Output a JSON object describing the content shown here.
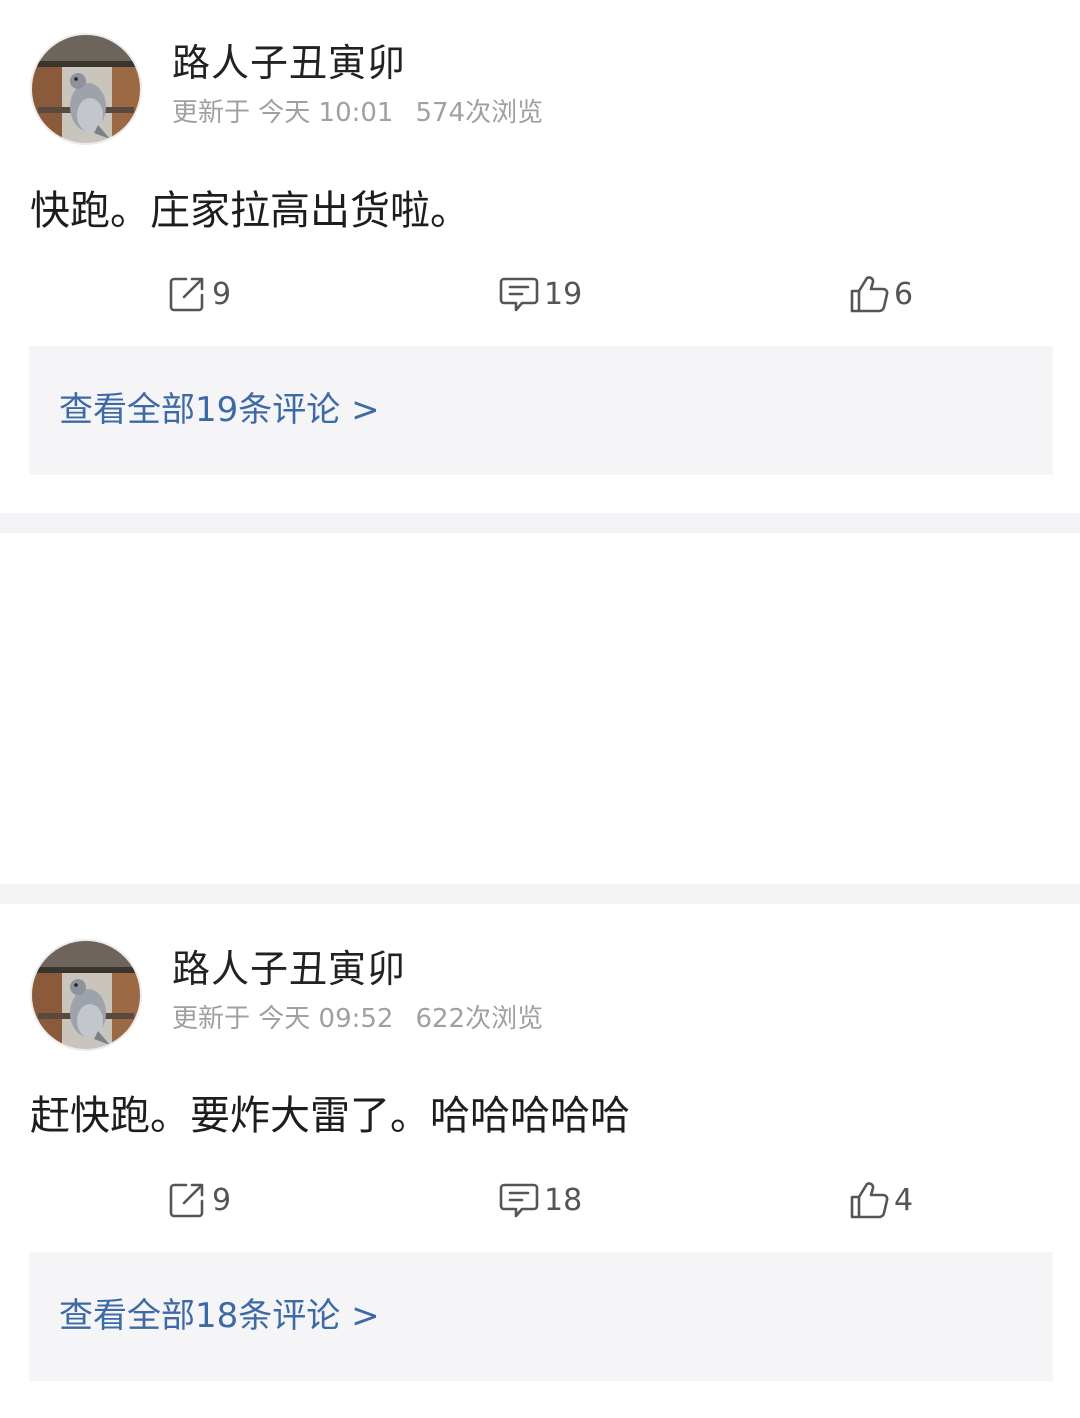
{
  "colors": {
    "link": "#3d6aa6",
    "meta": "#a0a0a0",
    "divider": "#f3f3f5",
    "comment_box": "#f5f5f7"
  },
  "posts": [
    {
      "author": "路人子丑寅卯",
      "updated": "更新于 今天 10:01",
      "views": "574次浏览",
      "content": "快跑。庄家拉高出货啦。",
      "shares": "9",
      "comments": "19",
      "likes": "6",
      "comments_link": "查看全部19条评论 >",
      "icons": {
        "share": "share-icon",
        "comment": "comment-icon",
        "like": "thumbs-up-icon"
      }
    },
    {
      "author": "路人子丑寅卯",
      "updated": "更新于 今天 09:52",
      "views": "622次浏览",
      "content": "赶快跑。要炸大雷了。哈哈哈哈哈",
      "shares": "9",
      "comments": "18",
      "likes": "4",
      "comments_link": "查看全部18条评论 >",
      "icons": {
        "share": "share-icon",
        "comment": "comment-icon",
        "like": "thumbs-up-icon"
      }
    }
  ]
}
